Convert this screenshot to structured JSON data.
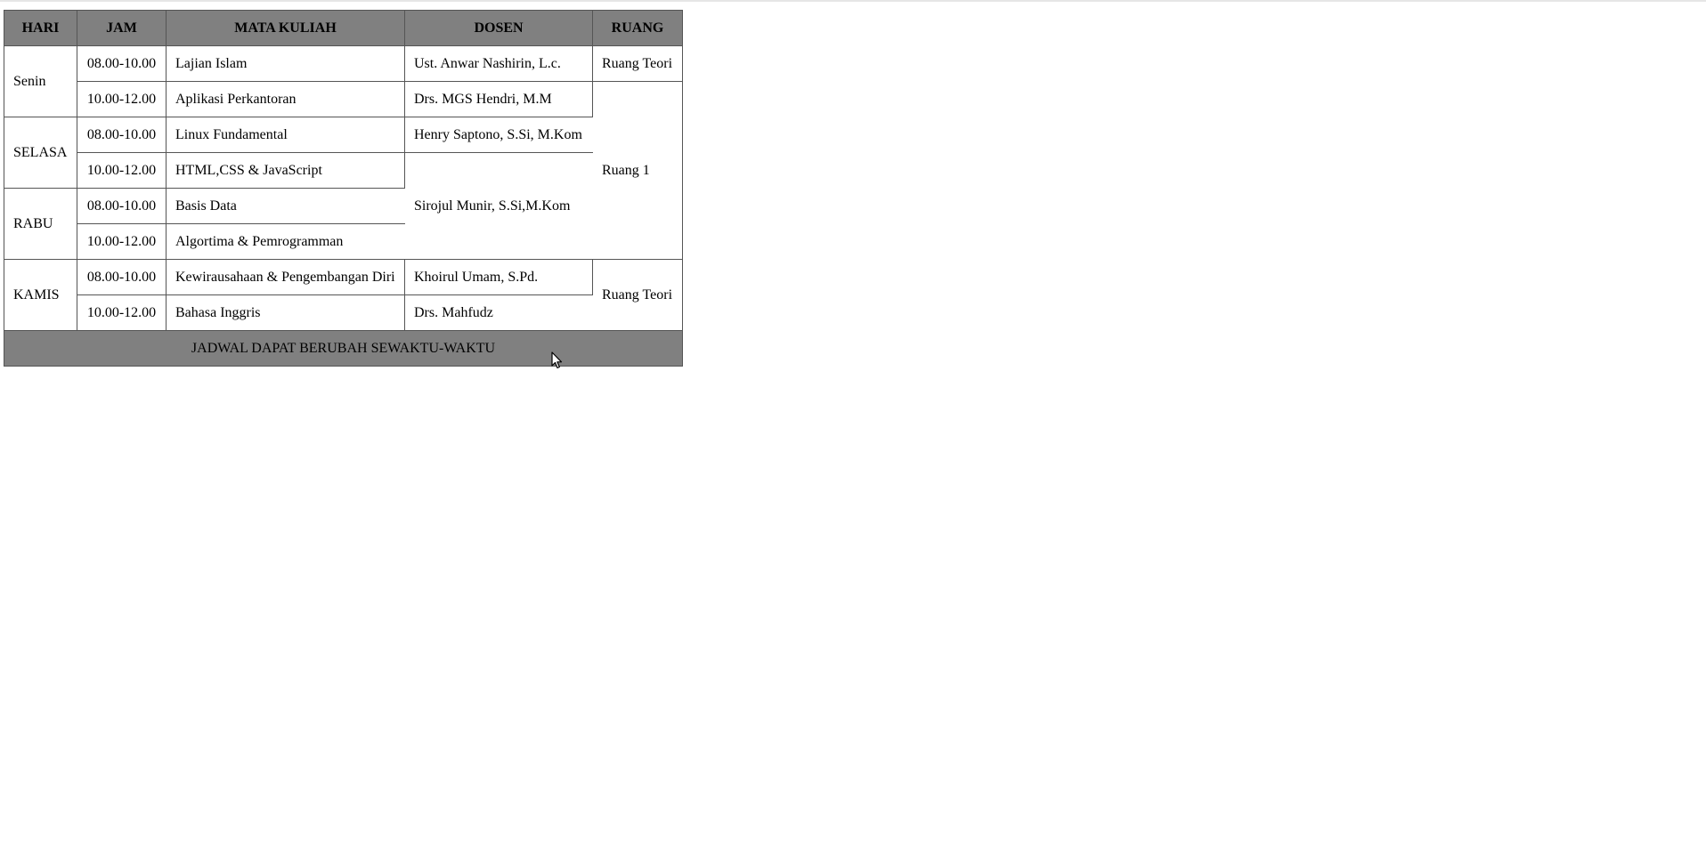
{
  "table": {
    "headers": {
      "day": "HARI",
      "time": "JAM",
      "course": "MATA KULIAH",
      "lecturer": "DOSEN",
      "room": "RUANG"
    },
    "days": [
      "Senin",
      "SELASA",
      "RABU",
      "KAMIS"
    ],
    "rows": [
      {
        "time": "08.00-10.00",
        "course": "Lajian Islam"
      },
      {
        "time": "10.00-12.00",
        "course": "Aplikasi Perkantoran"
      },
      {
        "time": "08.00-10.00",
        "course": "Linux Fundamental"
      },
      {
        "time": "10.00-12.00",
        "course": "HTML,CSS & JavaScript"
      },
      {
        "time": "08.00-10.00",
        "course": "Basis Data"
      },
      {
        "time": "10.00-12.00",
        "course": "Algortima & Pemrogramman"
      },
      {
        "time": "08.00-10.00",
        "course": "Kewirausahaan & Pengembangan Diri"
      },
      {
        "time": "10.00-12.00",
        "course": "Bahasa Inggris"
      }
    ],
    "lecturers": [
      "Ust. Anwar Nashirin, L.c.",
      "Drs. MGS Hendri, M.M",
      "Henry Saptono, S.Si, M.Kom",
      "Sirojul Munir, S.Si,M.Kom",
      "Khoirul Umam, S.Pd.",
      "Drs. Mahfudz"
    ],
    "rooms": [
      "Ruang Teori",
      "Ruang 1",
      "Ruang Teori"
    ],
    "footer": "JADWAL DAPAT BERUBAH SEWAKTU-WAKTU"
  },
  "colors": {
    "header_bg": "#808080",
    "border": "#555555",
    "page_bg": "#ffffff"
  },
  "icons": {
    "cursor": "mouse-pointer-icon"
  }
}
